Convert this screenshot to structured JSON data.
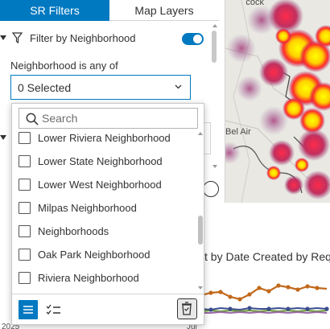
{
  "tabs": [
    {
      "label": "SR Filters",
      "active": true
    },
    {
      "label": "Map Layers",
      "active": false
    }
  ],
  "filter": {
    "title": "Filter by Neighborhood",
    "enabled": true,
    "condition_label": "Neighborhood is any of",
    "select_value": "0 Selected"
  },
  "dropdown": {
    "search_placeholder": "Search",
    "items": [
      {
        "label": "Lower Riviera Neighborhood",
        "checked": false
      },
      {
        "label": "Lower State Neighborhood",
        "checked": false
      },
      {
        "label": "Lower West Neighborhood",
        "checked": false
      },
      {
        "label": "Milpas Neighborhood",
        "checked": false
      },
      {
        "label": "Neighborhoods",
        "checked": false
      },
      {
        "label": "Oak Park Neighborhood",
        "checked": false
      },
      {
        "label": "Riviera Neighborhood",
        "checked": false
      }
    ]
  },
  "map": {
    "label_top": "cock",
    "label_belair": "Bel Air"
  },
  "chart": {
    "title_fragment": "t by Date Created by Req",
    "x_ticks": [
      "2025",
      "Jul"
    ]
  },
  "colors": {
    "accent": "#0079c1",
    "heat_hot": "#ffff00",
    "heat_warm": "#ff3030",
    "heat_cool": "#b0306a"
  }
}
